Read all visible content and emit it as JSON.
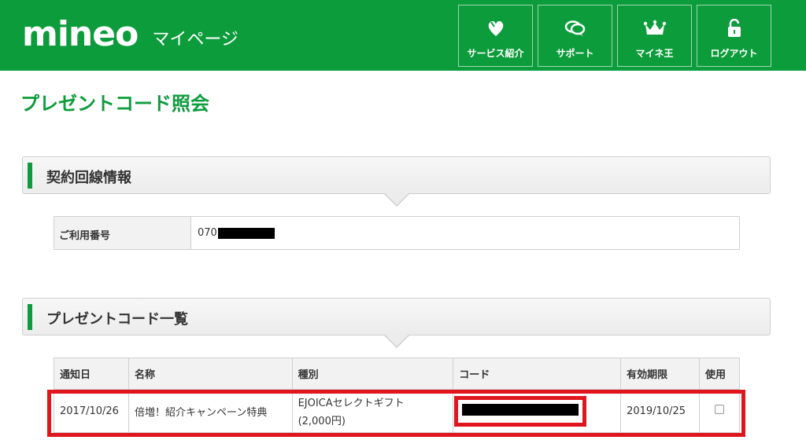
{
  "header": {
    "logo": "mineo",
    "subtitle": "マイページ",
    "nav": [
      {
        "label": "サービス紹介",
        "icon": "heart-leaf-icon"
      },
      {
        "label": "サポート",
        "icon": "chat-bubbles-icon"
      },
      {
        "label": "マイネ王",
        "icon": "crown-icon"
      },
      {
        "label": "ログアウト",
        "icon": "unlock-icon"
      }
    ]
  },
  "page_title": "プレゼントコード照会",
  "contract": {
    "section_title": "契約回線情報",
    "label": "ご利用番号",
    "value_prefix": "070"
  },
  "codes": {
    "section_title": "プレゼントコード一覧",
    "columns": [
      "通知日",
      "名称",
      "種別",
      "コード",
      "有効期限",
      "使用"
    ],
    "rows": [
      {
        "date": "2017/10/26",
        "name": "倍増！紹介キャンペーン特典",
        "type_line1": "EJOICAセレクトギフト",
        "type_line2": "(2,000円)",
        "expiry": "2019/10/25"
      }
    ]
  },
  "colors": {
    "brand_green": "#0d9c3c",
    "highlight_red": "#e0161f"
  }
}
